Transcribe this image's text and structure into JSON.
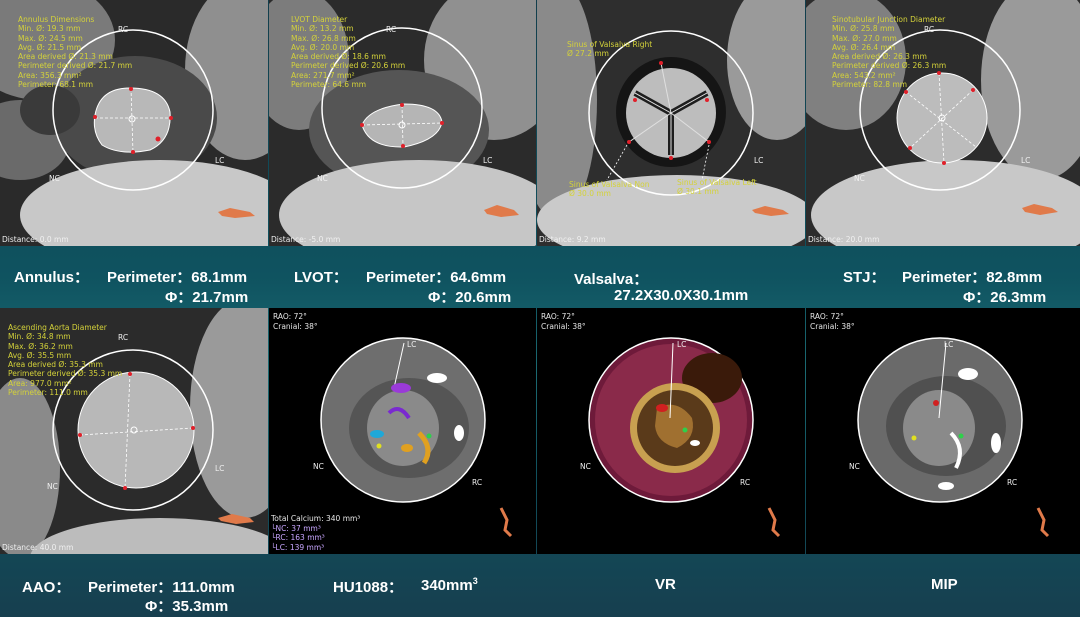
{
  "panels": {
    "annulus": {
      "measurements": [
        "Annulus Dimensions",
        "Min. Ø: 19.3 mm",
        "Max. Ø: 24.5 mm",
        "Avg. Ø: 21.5 mm",
        "Area derived Ø: 21.3 mm",
        "Perimeter derived Ø: 21.7 mm",
        "Area: 356.3 mm²",
        "Perimeter: 68.1 mm"
      ],
      "labels": {
        "rc": "RC",
        "lc": "LC",
        "nc": "NC"
      },
      "distance": "Distance: 0.0 mm"
    },
    "lvot": {
      "measurements": [
        "LVOT Diameter",
        "Min. Ø: 13.2 mm",
        "Max. Ø: 26.8 mm",
        "Avg. Ø: 20.0 mm",
        "Area derived Ø: 18.6 mm",
        "Perimeter derived Ø: 20.6 mm",
        "Area: 271.7 mm²",
        "Perimeter: 64.6 mm"
      ],
      "labels": {
        "rc": "RC",
        "lc": "LC",
        "nc": "NC"
      },
      "distance": "Distance: -5.0 mm"
    },
    "valsalva": {
      "title_right": "Sinus of Valsalva Right\nØ 27.2 mm",
      "title_non": "Sinus of Valsalva Non\nØ 30.0 mm",
      "title_left": "Sinus of Valsalva Left\nØ 30.1 mm",
      "labels": {
        "lc": "LC"
      },
      "distance": "Distance: 9.2 mm"
    },
    "stj": {
      "measurements": [
        "Sinotubular Junction Diameter",
        "Min. Ø: 25.8 mm",
        "Max. Ø: 27.0 mm",
        "Avg. Ø: 26.4 mm",
        "Area derived Ø: 26.3 mm",
        "Perimeter derived Ø: 26.3 mm",
        "Area: 543.2 mm²",
        "Perimeter: 82.8 mm"
      ],
      "labels": {
        "rc": "RC",
        "lc": "LC",
        "nc": "NC"
      },
      "distance": "Distance: 20.0 mm"
    },
    "aao": {
      "measurements": [
        "Ascending Aorta Diameter",
        "Min. Ø: 34.8 mm",
        "Max. Ø: 36.2 mm",
        "Avg. Ø: 35.5 mm",
        "Area derived Ø: 35.3 mm",
        "Perimeter derived Ø: 35.3 mm",
        "Area: 977.0 mm²",
        "Perimeter: 111.0 mm"
      ],
      "labels": {
        "rc": "RC",
        "lc": "LC",
        "nc": "NC"
      },
      "distance": "Distance: 40.0 mm"
    },
    "calcium": {
      "orient": [
        "RAO: 72°",
        "Cranial: 38°"
      ],
      "labels": {
        "lc": "LC",
        "nc": "NC",
        "rc": "RC"
      },
      "total": "Total Calcium: 340 mm³",
      "nc": "└NC: 37 mm³",
      "rc": "└RC: 163 mm³",
      "lc": "└LC: 139 mm³"
    },
    "vr": {
      "orient": [
        "RAO: 72°",
        "Cranial: 38°"
      ],
      "labels": {
        "lc": "LC",
        "nc": "NC",
        "rc": "RC"
      }
    },
    "mip": {
      "orient": [
        "RAO: 72°",
        "Cranial: 38°"
      ],
      "labels": {
        "lc": "LC",
        "nc": "NC",
        "rc": "RC"
      }
    }
  },
  "captions": {
    "annulus_name": "Annulus：",
    "annulus_perimeter": "Perimeter：68.1mm",
    "annulus_phi": "Φ：21.7mm",
    "lvot_name": "LVOT：",
    "lvot_perimeter": "Perimeter：64.6mm",
    "lvot_phi": "Φ：20.6mm",
    "valsalva_name": "Valsalva：",
    "valsalva_values": "27.2X30.0X30.1mm",
    "stj_name": "STJ：",
    "stj_perimeter": "Perimeter：82.8mm",
    "stj_phi": "Φ：26.3mm",
    "aao_name": "AAO：",
    "aao_perimeter": "Perimeter：111.0mm",
    "aao_phi": "Φ：35.3mm",
    "hu_name": "HU1088：",
    "hu_value": "340mm",
    "hu_sup": "3",
    "vr": "VR",
    "mip": "MIP"
  },
  "colors": {
    "measurement_text": "#d4d23a",
    "caption_text": "#ffffff",
    "background_teal": "#0f5360",
    "marker_red": "#e0202a"
  }
}
